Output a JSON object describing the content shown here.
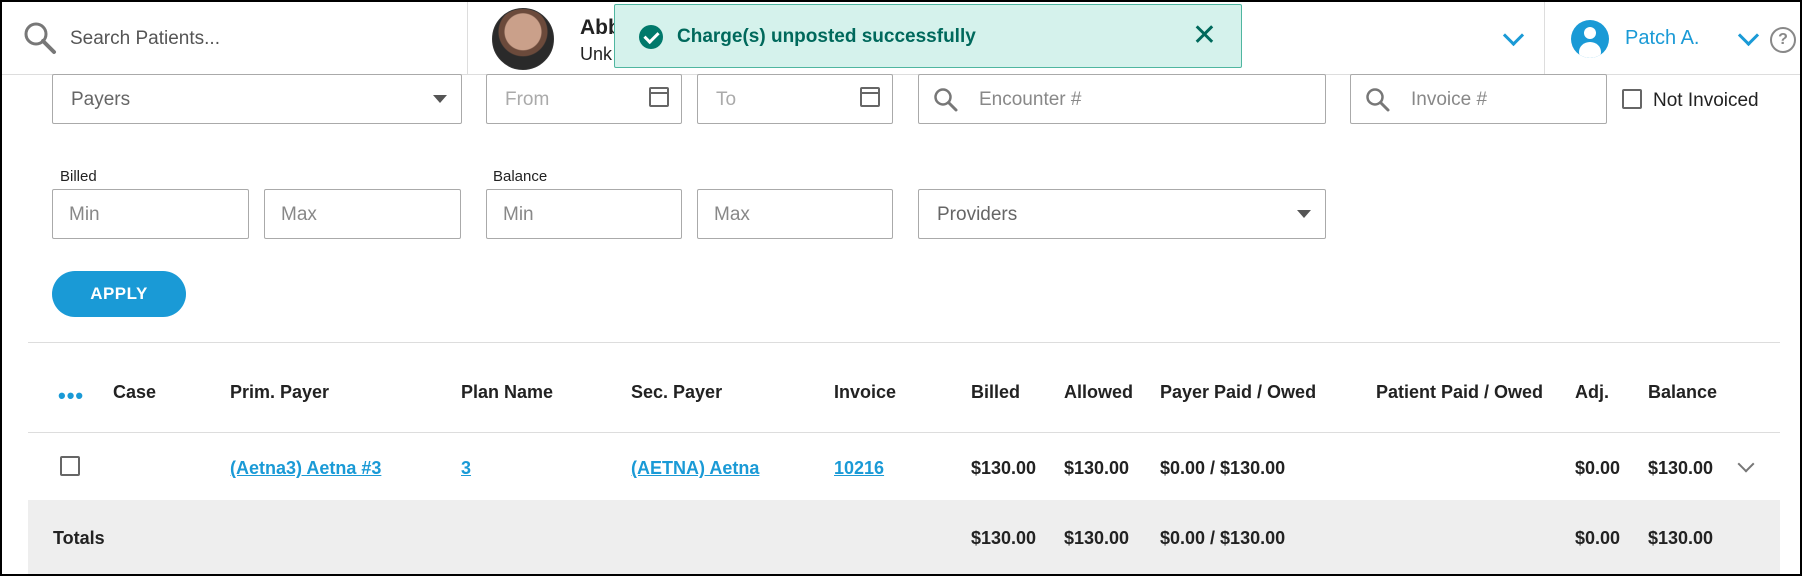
{
  "search": {
    "placeholder": "Search Patients..."
  },
  "patient": {
    "name": "Abb",
    "subtitle": "Unk"
  },
  "toast": {
    "message": "Charge(s) unposted successfully",
    "close": "✕"
  },
  "user": {
    "name": "Patch A."
  },
  "help": {
    "label": "?"
  },
  "filters": {
    "payers_placeholder": "Payers",
    "from_placeholder": "From",
    "to_placeholder": "To",
    "encounter_placeholder": "Encounter #",
    "invoice_placeholder": "Invoice #",
    "not_invoiced_label": "Not Invoiced",
    "billed_label": "Billed",
    "balance_label": "Balance",
    "min_placeholder": "Min",
    "max_placeholder": "Max",
    "providers_placeholder": "Providers",
    "apply_label": "APPLY"
  },
  "table": {
    "options_icon": "•••",
    "headers": [
      "Case",
      "Prim. Payer",
      "Plan Name",
      "Sec. Payer",
      "Invoice",
      "Billed",
      "Allowed",
      "Payer Paid / Owed",
      "Patient Paid / Owed",
      "Adj.",
      "Balance"
    ],
    "row": {
      "case": "",
      "prim_payer": "(Aetna3) Aetna #3",
      "plan_name": "3",
      "sec_payer": "(AETNA) Aetna",
      "invoice": "10216",
      "billed": "$130.00",
      "allowed": "$130.00",
      "payer_paid_owed": "$0.00 / $130.00",
      "patient_paid_owed": "",
      "adj": "$0.00",
      "balance": "$130.00"
    },
    "totals": {
      "label": "Totals",
      "billed": "$130.00",
      "allowed": "$130.00",
      "payer_paid_owed": "$0.00 / $130.00",
      "adj": "$0.00",
      "balance": "$130.00"
    }
  },
  "colors": {
    "accent": "#1a9ad6",
    "toast_bg": "#d5f2ec",
    "toast_text": "#00695c"
  }
}
